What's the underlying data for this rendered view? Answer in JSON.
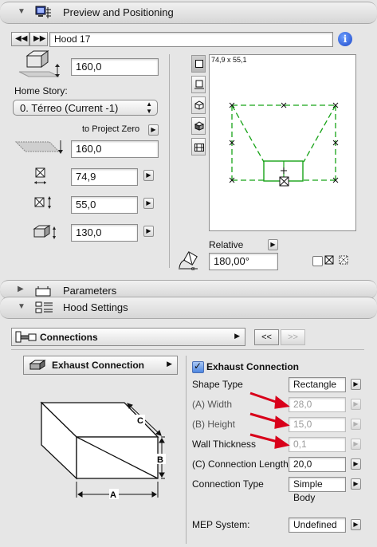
{
  "preview": {
    "title": "Preview and Positioning",
    "object_name": "Hood 17",
    "elevation_value": "160,0",
    "home_story_label": "Home Story:",
    "home_story_value": "0. Térreo (Current -1)",
    "to_project_zero_label": "to Project Zero",
    "project_zero_value": "160,0",
    "width_value": "74,9",
    "depth_value": "55,0",
    "height_value": "130,0",
    "preview_size_label": "74,9 x 55,1",
    "relative_label": "Relative",
    "angle_value": "180,00°"
  },
  "parameters_title": "Parameters",
  "hood": {
    "title": "Hood Settings",
    "page_select_value": "Connections",
    "prev_page": "<<",
    "next_page": ">>",
    "subpanel_value": "Exhaust Connection",
    "diagram_labels": {
      "a": "A",
      "b": "B",
      "c": "C"
    },
    "exhaust_checkbox_label": "Exhaust Connection",
    "exhaust_checked": true,
    "rows": {
      "shape_type_label": "Shape Type",
      "shape_type_value": "Rectangle",
      "width_label": "(A) Width",
      "width_value": "28,0",
      "height_label": "(B) Height",
      "height_value": "15,0",
      "wall_label": "Wall Thickness",
      "wall_value": "0,1",
      "length_label": "(C) Connection Length",
      "length_value": "20,0",
      "conn_type_label": "Connection Type",
      "conn_type_value": "Simple Body",
      "mep_label": "MEP System:",
      "mep_value": "Undefined"
    },
    "annotation_color": "#d8001a"
  }
}
